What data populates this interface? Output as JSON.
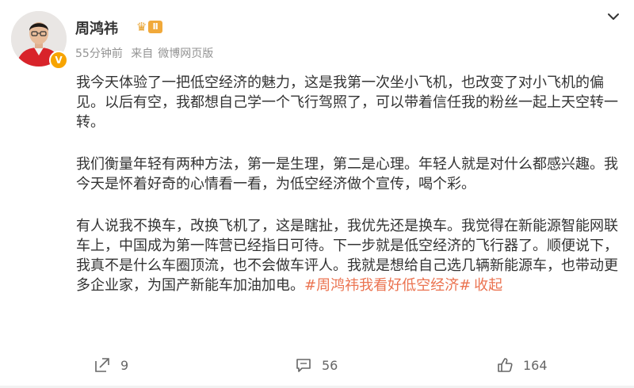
{
  "user": {
    "name": "周鸿祎",
    "level": "Ⅱ",
    "verified_mark": "V"
  },
  "meta": {
    "time": "55分钟前",
    "source_prefix": "来自",
    "source": "微博网页版"
  },
  "post": {
    "paragraphs": [
      "我今天体验了一把低空经济的魅力，这是我第一次坐小飞机，也改变了对小飞机的偏见。以后有空，我都想自己学一个飞行驾照了，可以带着信任我的粉丝一起上天空转一转。",
      "我们衡量年轻有两种方法，第一是生理，第二是心理。年轻人就是对什么都感兴趣。我今天是怀着好奇的心情看一看，为低空经济做个宣传，喝个彩。",
      "有人说我不换车，改换飞机了，这是瞎扯，我优先还是换车。我觉得在新能源智能网联车上，中国成为第一阵营已经指日可待。下一步就是低空经济的飞行器了。顺便说下，我真不是什么车圈顶流，也不会做车评人。我就是想给自己选几辆新能源车，也带动更多企业家，为国产新能车加油加电。"
    ],
    "hashtag": "#周鸿祎我看好低空经济#",
    "collapse_label": "收起"
  },
  "actions": {
    "repost_count": "9",
    "comment_count": "56",
    "like_count": "164"
  },
  "colors": {
    "accent": "#eb7350",
    "text": "#333333",
    "meta": "#939393",
    "vip": "#f7a400"
  },
  "icons": [
    "more-chevron-icon",
    "repost-icon",
    "comment-icon",
    "like-icon",
    "verified-icon",
    "crown-icon"
  ]
}
